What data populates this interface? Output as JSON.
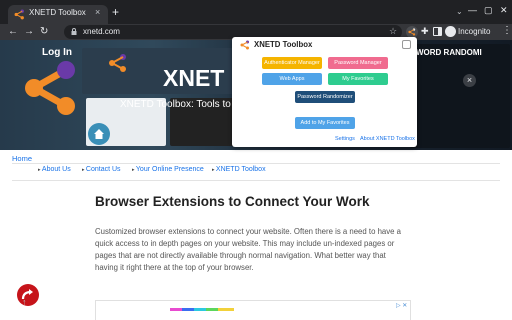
{
  "browser": {
    "tab_title": "XNETD Toolbox",
    "tab_close": "×",
    "new_tab": "+",
    "url": "xnetd.com",
    "profile_label": "Incognito",
    "menu": "⋮",
    "tab_search": "⌄",
    "win_minimize": "—",
    "win_maximize": "▢",
    "win_close": "✕"
  },
  "hero": {
    "login": "Log In",
    "title": "XNET",
    "subtitle": "XNETD Toolbox: Tools to h",
    "right_partial": "WORD RANDOMI",
    "close": "×"
  },
  "breadcrumb": {
    "home": "Home"
  },
  "nav_links": [
    "About Us",
    "Contact Us",
    "Your Online Presence",
    "XNETD Toolbox"
  ],
  "article": {
    "heading": "Browser Extensions to Connect Your Work",
    "lines": [
      "Customized browser extensions to connect your website. Often there is a need to have a",
      "quick access to in depth pages on your website.  This may include un-indexed pages or",
      "pages that are not directly available through normal navigation. What better way that",
      "having it right there at the top of your browser."
    ]
  },
  "popup": {
    "title": "XNETD Toolbox",
    "buttons": [
      {
        "label": "Authenticator Manager",
        "color": "#f5b400"
      },
      {
        "label": "Password Manager",
        "color": "#f06b8f"
      },
      {
        "label": "Web Apps",
        "color": "#4fa3e8"
      },
      {
        "label": "My Favorites",
        "color": "#2ecc8f"
      },
      {
        "label": "Password Randomizer",
        "color": "#1f4e79"
      },
      {
        "label": "Add to My Favorites",
        "color": "#4fa3e8"
      }
    ],
    "settings_link": "Settings",
    "about_link": "About XNETD Toolbox"
  },
  "colors": {
    "accent": "#e03a2e",
    "link": "#1a73e8",
    "brand_orange": "#f28c28",
    "brand_purple": "#6a3aa8"
  },
  "icons": [
    "lock-icon",
    "star-icon",
    "puzzle-icon",
    "side-panel-icon",
    "incognito-icon",
    "home-icon",
    "up-arrow-icon",
    "settings-icon"
  ]
}
